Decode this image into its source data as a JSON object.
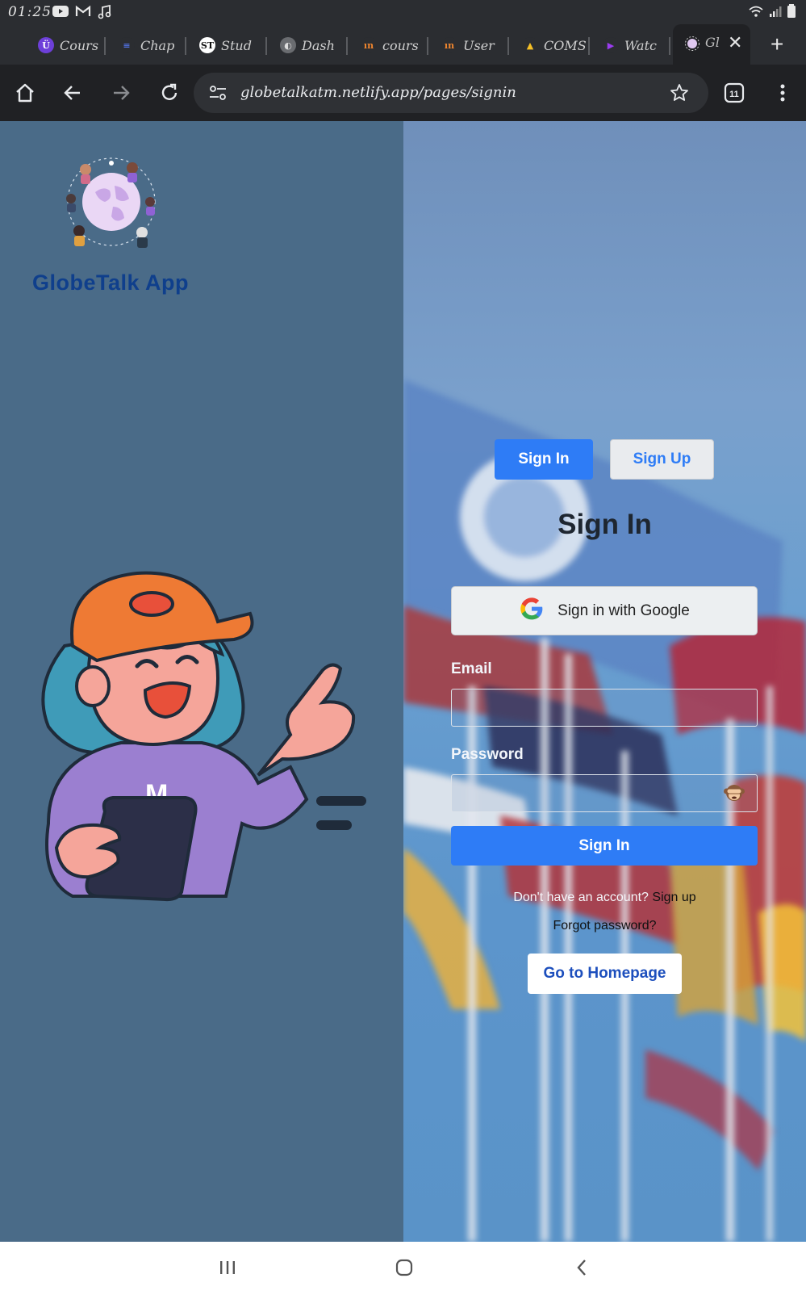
{
  "status": {
    "time": "01:25"
  },
  "tabs": [
    {
      "label": "Cours",
      "icon": "course-icon",
      "fav_bg": "#6d3fd9",
      "fav_fg": "#fff",
      "fav_char": "Ü"
    },
    {
      "label": "Chap",
      "icon": "chapter-icon",
      "fav_bg": "#2b2d31",
      "fav_fg": "#4f6dd8",
      "fav_char": "≡"
    },
    {
      "label": "Stud",
      "icon": "st-icon",
      "fav_bg": "#ffffff",
      "fav_fg": "#111",
      "fav_char": "ST"
    },
    {
      "label": "Dash",
      "icon": "globe-icon",
      "fav_bg": "#6a6c70",
      "fav_fg": "#ddd",
      "fav_char": "◐"
    },
    {
      "label": "cours",
      "icon": "in-icon",
      "fav_bg": "#2b2d31",
      "fav_fg": "#f0862f",
      "fav_char": "ın"
    },
    {
      "label": "User",
      "icon": "in-icon",
      "fav_bg": "#2b2d31",
      "fav_fg": "#f0862f",
      "fav_char": "ın"
    },
    {
      "label": "COMS",
      "icon": "drive-icon",
      "fav_bg": "#2b2d31",
      "fav_fg": "#f6c026",
      "fav_char": "▲"
    },
    {
      "label": "Watc",
      "icon": "play-icon",
      "fav_bg": "#2b2d31",
      "fav_fg": "#9b3cf0",
      "fav_char": "▶"
    }
  ],
  "active_tab": {
    "label": "Gl"
  },
  "toolbar": {
    "url": "globetalkatm.netlify.app/pages/signin"
  },
  "left": {
    "brand": "GlobeTalk App"
  },
  "form": {
    "tab_signin": "Sign In",
    "tab_signup": "Sign Up",
    "title": "Sign In",
    "google_label": "Sign in with Google",
    "email_label": "Email",
    "email_value": "",
    "password_label": "Password",
    "password_value": "",
    "submit_label": "Sign In",
    "no_account_text": "Don't have an account?",
    "signup_link": "Sign up",
    "forgot": "Forgot password?",
    "home_button": "Go to Homepage"
  },
  "colors": {
    "primary": "#2e7cf6",
    "brand": "#0f3f8c",
    "left_bg": "#4a6b88"
  }
}
